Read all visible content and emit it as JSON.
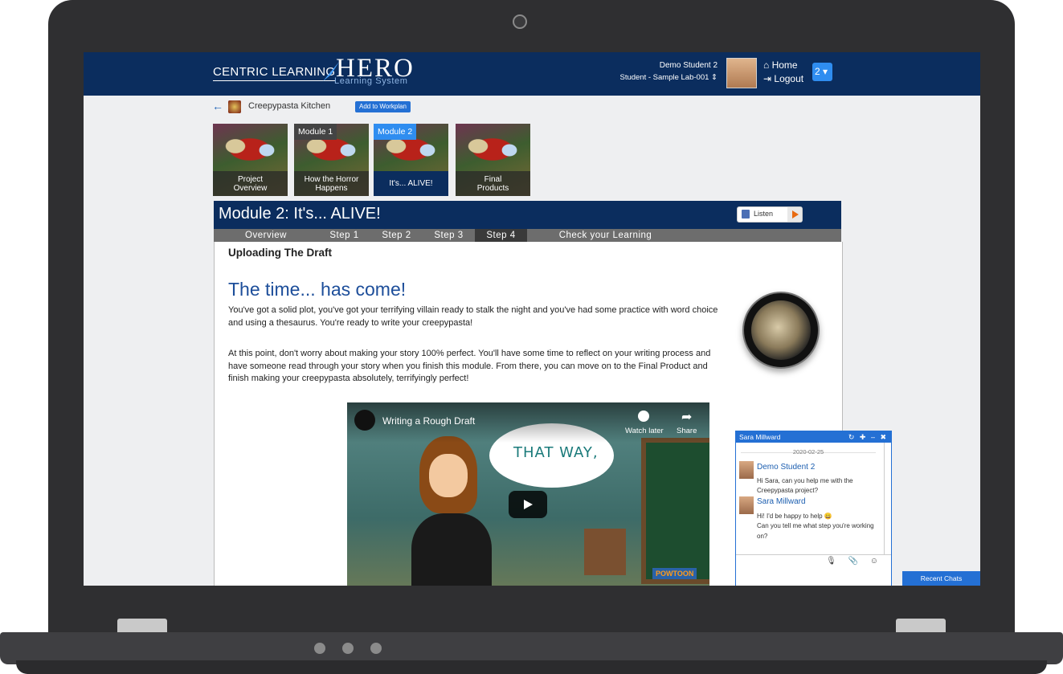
{
  "header": {
    "brand_left": "CENTRIC LEARNING",
    "brand_hero": "HERO",
    "brand_sub": "Learning System",
    "user_name": "Demo Student 2",
    "user_class": "Student - Sample Lab-001 ⇕",
    "home": "⌂ Home",
    "logout": "⇥ Logout",
    "badge": "2 ▾"
  },
  "breadcrumb": {
    "back": "←",
    "title": "Creepypasta Kitchen",
    "workplan": "Add to Workplan"
  },
  "tiles": [
    {
      "label": "Project\nOverview",
      "tag": ""
    },
    {
      "label": "How the Horror\nHappens",
      "tag": "Module 1"
    },
    {
      "label": "It's... ALIVE!",
      "tag": "Module 2"
    },
    {
      "label": "Final\nProducts",
      "tag": ""
    }
  ],
  "module": {
    "title": "Module 2: It's... ALIVE!",
    "listen": "Listen",
    "steps": [
      "Overview",
      "Step 1",
      "Step 2",
      "Step 3",
      "Step 4",
      "Check your Learning"
    ],
    "active_step": "Step 4"
  },
  "content": {
    "section_title": "Uploading The Draft",
    "heading": "The time... has come!",
    "para1": "You've got a solid plot, you've got your terrifying villain ready to stalk the night and you've had some practice with word choice and using a thesaurus. You're ready to write your creepypasta!",
    "para2": "At this point, don't worry about making your story 100% perfect. You'll have some time to reflect on your writing process and have someone read through your story when you finish this module. From there, you can move on to the Final Product and finish making your creepypasta absolutely, terrifyingly perfect!"
  },
  "video": {
    "title": "Writing a Rough Draft",
    "watch_later": "Watch later",
    "share": "Share",
    "bubble": "THAT WAY,",
    "watermark": "POWTOON"
  },
  "chat": {
    "name": "Sara Millward",
    "header_icons": "↻ ✚ – ✖",
    "date": "2020-02-25",
    "messages": [
      {
        "from": "Demo Student 2",
        "text": "Hi Sara, can you help me with the Creepypasta project?"
      },
      {
        "from": "Sara Millward",
        "text": "Hi! I'd be happy to help 😀\nCan you tell me what step you're working on?"
      }
    ],
    "tools": "🎙 📎 ☺"
  },
  "recent_chats": "Recent Chats"
}
